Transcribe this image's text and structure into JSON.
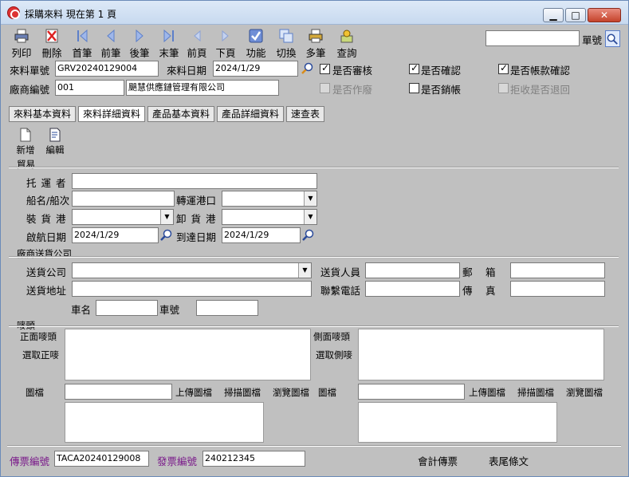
{
  "window": {
    "title": "採購來料  現在第 1 頁",
    "min": "▁",
    "max": "□",
    "close": "✕"
  },
  "toolbar": {
    "items": [
      {
        "label": "列印",
        "icon": "printer-icon"
      },
      {
        "label": "刪除",
        "icon": "delete-icon"
      },
      {
        "label": "首筆",
        "icon": "first-record-icon"
      },
      {
        "label": "前筆",
        "icon": "prev-record-icon"
      },
      {
        "label": "後筆",
        "icon": "next-record-icon"
      },
      {
        "label": "末筆",
        "icon": "last-record-icon"
      },
      {
        "label": "前頁",
        "icon": "prev-page-icon"
      },
      {
        "label": "下頁",
        "icon": "next-page-icon"
      },
      {
        "label": "功能",
        "icon": "function-icon"
      },
      {
        "label": "切換",
        "icon": "switch-icon"
      },
      {
        "label": "多筆",
        "icon": "multi-record-icon"
      },
      {
        "label": "查詢",
        "icon": "query-icon"
      }
    ],
    "search_value": "",
    "search_label": "單號"
  },
  "header": {
    "receipt_no_label": "來料單號",
    "receipt_no": "GRV20240129004",
    "receipt_date_label": "來料日期",
    "receipt_date": "2024/1/29",
    "vendor_no_label": "廠商編號",
    "vendor_no": "001",
    "vendor_name": "颶慧供應鏈管理有限公司",
    "checks": [
      {
        "label": "是否審核",
        "checked": true,
        "enabled": true
      },
      {
        "label": "是否確認",
        "checked": true,
        "enabled": true
      },
      {
        "label": "是否帳款確認",
        "checked": true,
        "enabled": true
      },
      {
        "label": "是否作廢",
        "checked": false,
        "enabled": false
      },
      {
        "label": "是否銷帳",
        "checked": false,
        "enabled": true
      },
      {
        "label": "拒收是否退回",
        "checked": false,
        "enabled": false
      }
    ]
  },
  "tabs": [
    "來料基本資料",
    "來料詳細資料",
    "產品基本資料",
    "產品詳細資料",
    "速查表"
  ],
  "active_tab": 1,
  "subtoolbar": {
    "new": "新增",
    "edit": "編輯"
  },
  "trade": {
    "title": "貿易",
    "carrier_label": "托 運 者",
    "carrier": "",
    "vessel_label": "船名/船次",
    "vessel": "",
    "transship_label": "轉運港口",
    "transship": "",
    "loading_port_label": "裝 貨 港",
    "loading_port": "",
    "discharge_port_label": "卸 貨 港",
    "discharge_port": "",
    "departure_label": "啟航日期",
    "departure": "2024/1/29",
    "arrival_label": "到達日期",
    "arrival": "2024/1/29"
  },
  "vendor_delivery": {
    "title": "廠商送貨公司",
    "company_label": "送貨公司",
    "company": "",
    "person_label": "送貨人員",
    "person": "",
    "zip_label": "郵　 箱",
    "zip": "",
    "address_label": "送貨地址",
    "address": "",
    "phone_label": "聯繫電話",
    "phone": "",
    "fax_label": "傳　 真",
    "fax": "",
    "car_name_label": "車名",
    "car_name": "",
    "car_no_label": "車號",
    "car_no": ""
  },
  "marks": {
    "title": "嘜頭",
    "front_label": "正面嘜頭",
    "front_select": "選取正嘜",
    "side_label": "側面嘜頭",
    "side_select": "選取側嘜",
    "image_label": "圖檔",
    "upload": "上傳圖檔",
    "scan": "掃描圖檔",
    "browse": "瀏覽圖檔",
    "image_label2": "圖檔",
    "upload2": "上傳圖檔",
    "scan2": "掃描圖檔",
    "browse2": "瀏覽圖檔"
  },
  "footer": {
    "voucher_label": "傳票編號",
    "voucher": "TACA20240129008",
    "invoice_label": "發票編號",
    "invoice": "240212345",
    "accounting": "會計傳票",
    "tail": "表尾條文"
  }
}
